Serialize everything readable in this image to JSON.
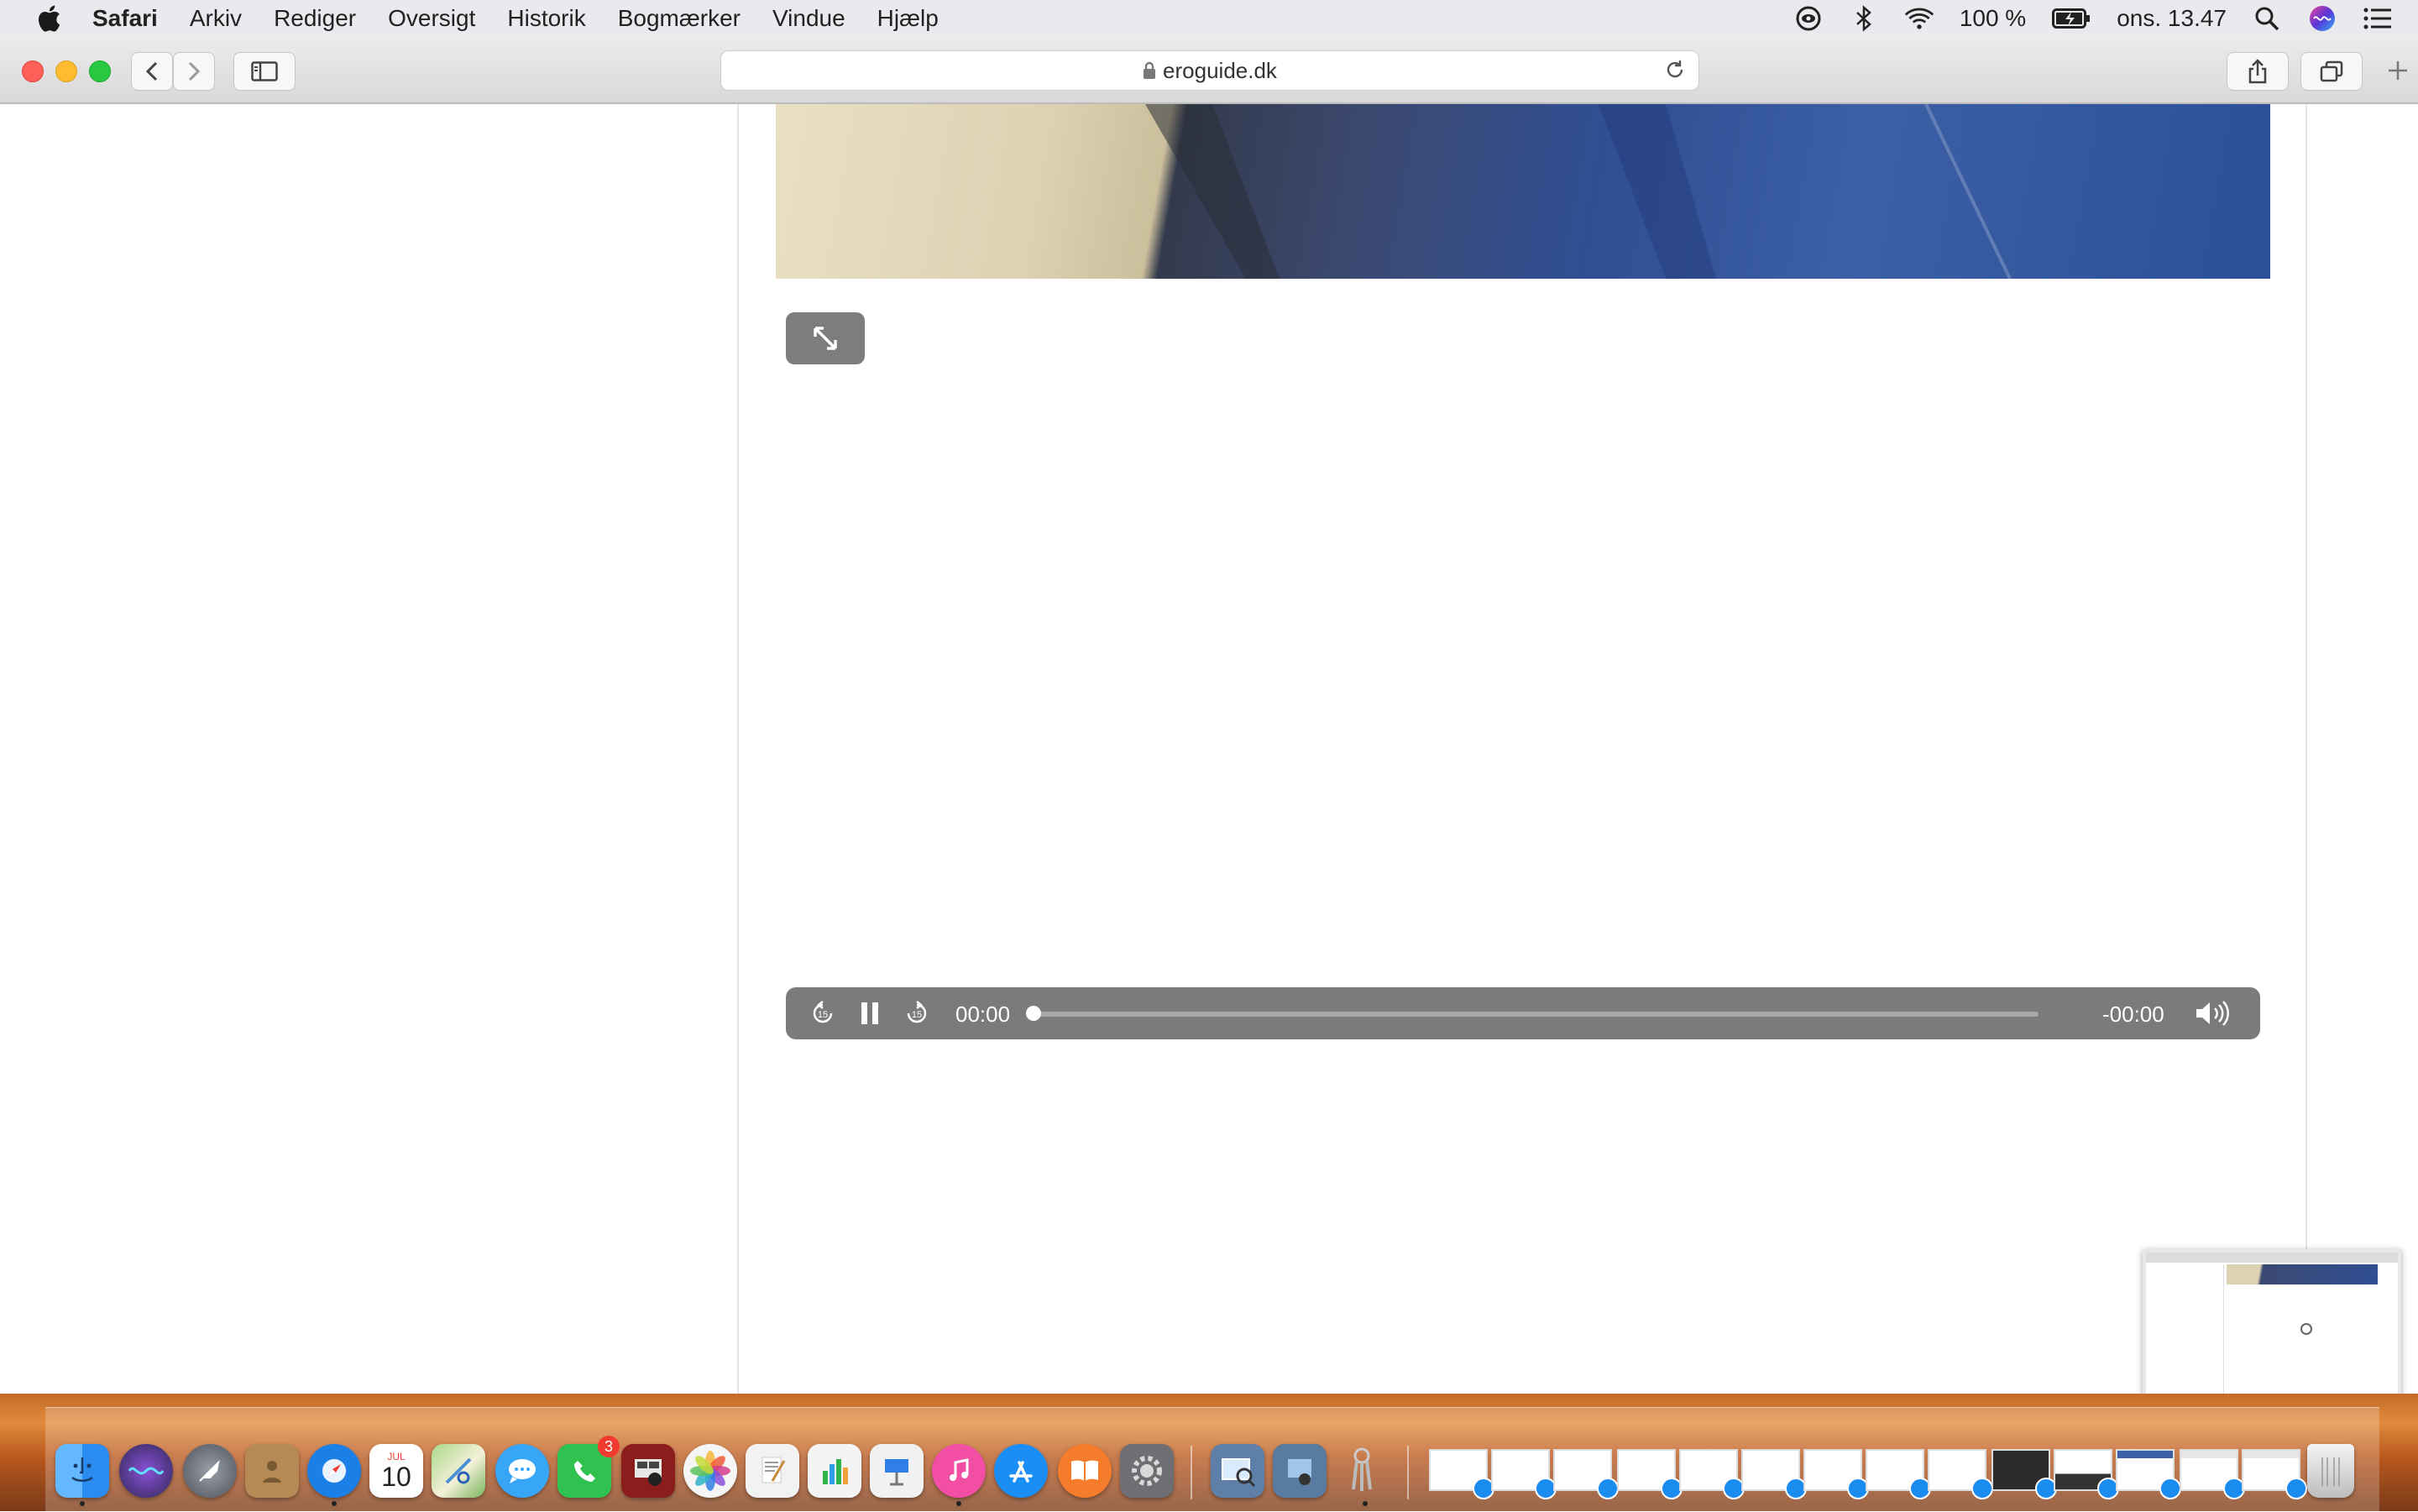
{
  "menubar": {
    "app_name": "Safari",
    "items": [
      "Arkiv",
      "Rediger",
      "Oversigt",
      "Historik",
      "Bogmærker",
      "Vindue",
      "Hjælp"
    ],
    "battery": "100 %",
    "clock": "ons. 13.47",
    "status_icons": [
      "eye-icon",
      "bluetooth-icon",
      "wifi-icon",
      "battery-icon",
      "search-icon",
      "siri-icon",
      "control-center-icon"
    ]
  },
  "toolbar": {
    "url": "eroguide.dk"
  },
  "player": {
    "current_time": "00:00",
    "remaining_time": "-00:00",
    "progress": 0
  },
  "dock": {
    "calendar_month": "JUL",
    "calendar_day": "10",
    "facetime_badge": "3",
    "apps": [
      "finder",
      "siri",
      "launchpad",
      "contacts",
      "safari",
      "calendar",
      "maps",
      "messages",
      "facetime",
      "photo-booth",
      "photos",
      "textedit",
      "numbers",
      "keynote",
      "itunes",
      "app-store",
      "books",
      "system-preferences",
      "preview",
      "image-capture",
      "keychain",
      "trash"
    ],
    "colors": {
      "finder": "#2a8cf1",
      "siri": "#2f2a57",
      "launchpad": "#6d6f78",
      "contacts": "#b58a55",
      "safari": "#1a7fe6",
      "calendar": "#ffffff",
      "maps": "#78b65c",
      "messages": "#38a6f7",
      "facetime": "#2fc250",
      "photo-booth": "#8c1d1d",
      "photos": "#f5f5f5",
      "textedit": "#f2f2f2",
      "numbers": "#f4f4f4",
      "keynote": "#f1f1f1",
      "itunes": "#f24ea4",
      "app-store": "#1b8ef5",
      "books": "#f47c2a",
      "system-preferences": "#6e6e73",
      "preview": "#5d7fa8",
      "image-capture": "#5a7ba0",
      "keychain": "#9a9aa0",
      "trash": "#d9d9d9"
    }
  }
}
